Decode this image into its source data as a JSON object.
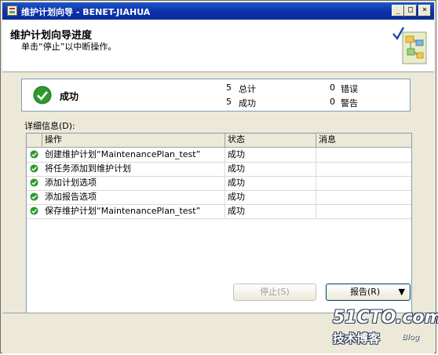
{
  "window": {
    "title": "维护计划向导 - BENET-JIAHUA",
    "minimize": "_",
    "maximize": "□",
    "close": "×"
  },
  "header": {
    "title": "维护计划向导进度",
    "subtitle": "单击“停止”以中断操作。"
  },
  "summary": {
    "status": "成功",
    "total_count": "5",
    "total_label": "总计",
    "success_count": "5",
    "success_label": "成功",
    "error_count": "0",
    "error_label": "错误",
    "warning_count": "0",
    "warning_label": "警告"
  },
  "details": {
    "label": "详细信息(D):",
    "columns": [
      "操作",
      "状态",
      "消息"
    ],
    "rows": [
      {
        "action": "创建维护计划“MaintenancePlan_test”",
        "status": "成功",
        "message": ""
      },
      {
        "action": "将任务添加到维护计划",
        "status": "成功",
        "message": ""
      },
      {
        "action": "添加计划选项",
        "status": "成功",
        "message": ""
      },
      {
        "action": "添加报告选项",
        "status": "成功",
        "message": ""
      },
      {
        "action": "保存维护计划“MaintenancePlan_test”",
        "status": "成功",
        "message": ""
      }
    ]
  },
  "buttons": {
    "stop": "停止(S)",
    "report": "报告(R)",
    "report_arrow": "▼"
  },
  "watermark": {
    "line1": "51CTO.com",
    "line2": "技术博客",
    "line3": "Blog"
  },
  "colors": {
    "title_bar": "#0a2ea8",
    "success_green": "#2e9a2e"
  },
  "icons": {
    "success": "green-check-circle-icon",
    "wizard": "wizard-banner-icon"
  }
}
